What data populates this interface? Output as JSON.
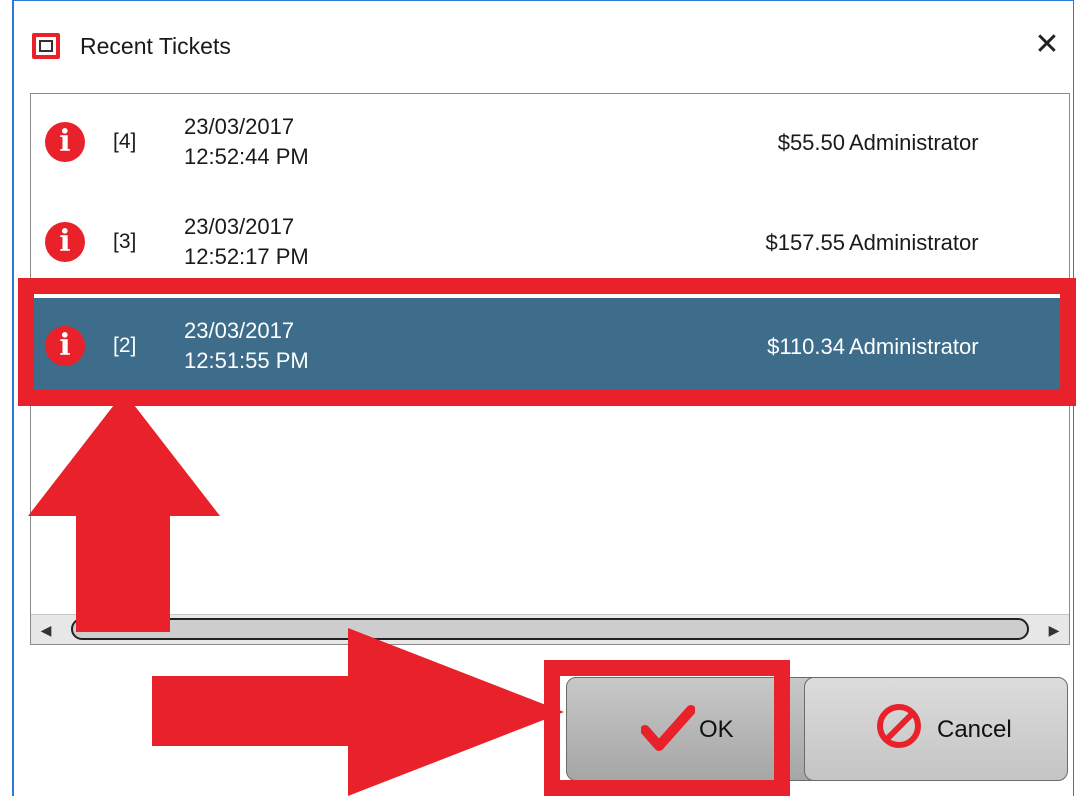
{
  "window": {
    "title": "Recent Tickets",
    "close_label": "✕"
  },
  "tickets": [
    {
      "id": "[4]",
      "date": "23/03/2017",
      "time": "12:52:44 PM",
      "amount": "$55.50",
      "user": "Administrator",
      "selected": false
    },
    {
      "id": "[3]",
      "date": "23/03/2017",
      "time": "12:52:17 PM",
      "amount": "$157.55",
      "user": "Administrator",
      "selected": false
    },
    {
      "id": "[2]",
      "date": "23/03/2017",
      "time": "12:51:55 PM",
      "amount": "$110.34",
      "user": "Administrator",
      "selected": true
    }
  ],
  "buttons": {
    "ok_label": "OK",
    "cancel_label": "Cancel"
  },
  "icons": {
    "info": "info-icon",
    "ok": "checkmark-icon",
    "cancel": "prohibited-icon"
  },
  "colors": {
    "accent_red": "#e8212a",
    "selection": "#3e6d8c"
  }
}
